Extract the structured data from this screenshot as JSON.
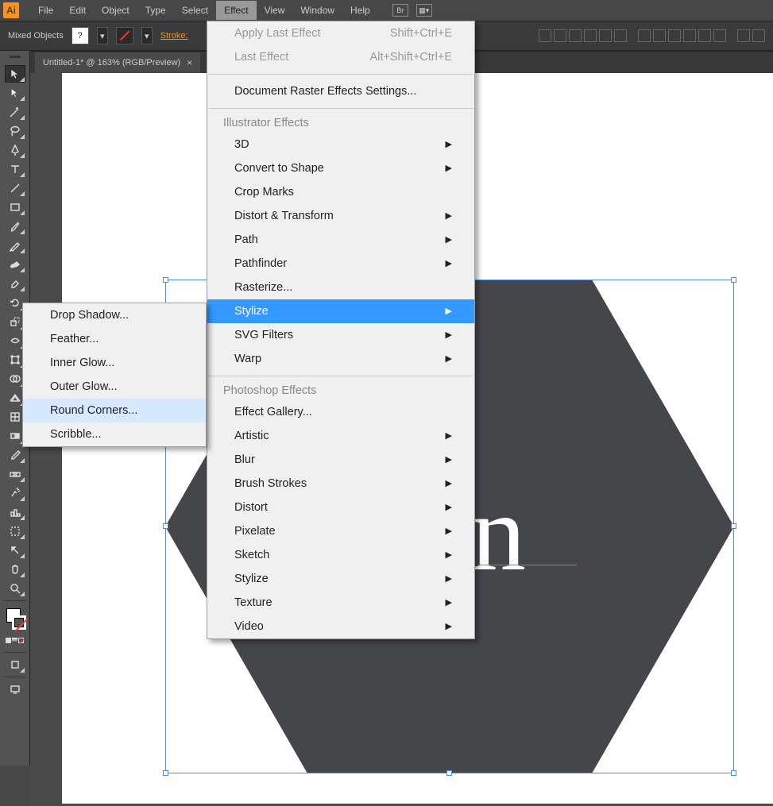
{
  "app": {
    "logo_text": "Ai"
  },
  "menubar": {
    "items": [
      "File",
      "Edit",
      "Object",
      "Type",
      "Select",
      "Effect",
      "View",
      "Window",
      "Help"
    ],
    "active_index": 5
  },
  "controlbar": {
    "selection_label": "Mixed Objects",
    "stroke_label": "Stroke:"
  },
  "tab": {
    "title": "Untitled-1* @ 163% (RGB/Preview)",
    "close": "×"
  },
  "canvas": {
    "hex_text": "n",
    "hex_fill": "#45464a"
  },
  "effect_menu": {
    "apply_last": {
      "label": "Apply Last Effect",
      "shortcut": "Shift+Ctrl+E"
    },
    "last": {
      "label": "Last Effect",
      "shortcut": "Alt+Shift+Ctrl+E"
    },
    "raster_settings": "Document Raster Effects Settings...",
    "section_illustrator": "Illustrator Effects",
    "illustrator_items": [
      {
        "label": "3D",
        "arrow": true
      },
      {
        "label": "Convert to Shape",
        "arrow": true
      },
      {
        "label": "Crop Marks",
        "arrow": false
      },
      {
        "label": "Distort & Transform",
        "arrow": true
      },
      {
        "label": "Path",
        "arrow": true
      },
      {
        "label": "Pathfinder",
        "arrow": true
      },
      {
        "label": "Rasterize...",
        "arrow": false
      },
      {
        "label": "Stylize",
        "arrow": true,
        "highlighted": true
      },
      {
        "label": "SVG Filters",
        "arrow": true
      },
      {
        "label": "Warp",
        "arrow": true
      }
    ],
    "section_photoshop": "Photoshop Effects",
    "photoshop_items": [
      {
        "label": "Effect Gallery...",
        "arrow": false
      },
      {
        "label": "Artistic",
        "arrow": true
      },
      {
        "label": "Blur",
        "arrow": true
      },
      {
        "label": "Brush Strokes",
        "arrow": true
      },
      {
        "label": "Distort",
        "arrow": true
      },
      {
        "label": "Pixelate",
        "arrow": true
      },
      {
        "label": "Sketch",
        "arrow": true
      },
      {
        "label": "Stylize",
        "arrow": true
      },
      {
        "label": "Texture",
        "arrow": true
      },
      {
        "label": "Video",
        "arrow": true
      }
    ]
  },
  "stylize_submenu": {
    "items": [
      "Drop Shadow...",
      "Feather...",
      "Inner Glow...",
      "Outer Glow...",
      "Round Corners...",
      "Scribble..."
    ],
    "hover_index": 4
  }
}
